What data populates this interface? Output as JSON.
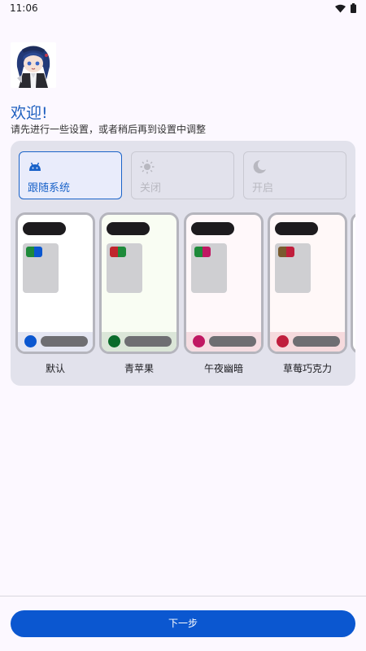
{
  "status": {
    "time": "11:06"
  },
  "welcome": {
    "title": "欢迎!",
    "subtitle": "请先进行一些设置，或者稍后再到设置中调整"
  },
  "modes": [
    {
      "label": "跟随系统",
      "icon": "android-icon",
      "selected": true
    },
    {
      "label": "关闭",
      "icon": "sun-icon",
      "selected": false
    },
    {
      "label": "开启",
      "icon": "moon-icon",
      "selected": false
    }
  ],
  "themes": [
    {
      "name": "默认",
      "accent": "#0b57d0",
      "chip": [
        "#1e8a3a",
        "#0b57d0"
      ],
      "bottom_bg": "#e4e6f2",
      "card_bg": "#ffffff"
    },
    {
      "name": "青苹果",
      "accent": "#0a6b2a",
      "chip": [
        "#c0262d",
        "#1e8a3a"
      ],
      "bottom_bg": "#dbe6d8",
      "card_bg": "#f9fdf3"
    },
    {
      "name": "午夜幽暗",
      "accent": "#c01862",
      "chip": [
        "#1e8a3a",
        "#c01862"
      ],
      "bottom_bg": "#f5dde2",
      "card_bg": "#fff8fa"
    },
    {
      "name": "草莓巧克力",
      "accent": "#c01e3c",
      "chip": [
        "#7a5a2e",
        "#c01e3c"
      ],
      "bottom_bg": "#f6dadd",
      "card_bg": "#fff8f8"
    }
  ],
  "next_button": {
    "label": "下一步"
  },
  "colors": {
    "primary": "#0b57d0",
    "title": "#1e5fbf",
    "background": "#fcf8ff"
  }
}
